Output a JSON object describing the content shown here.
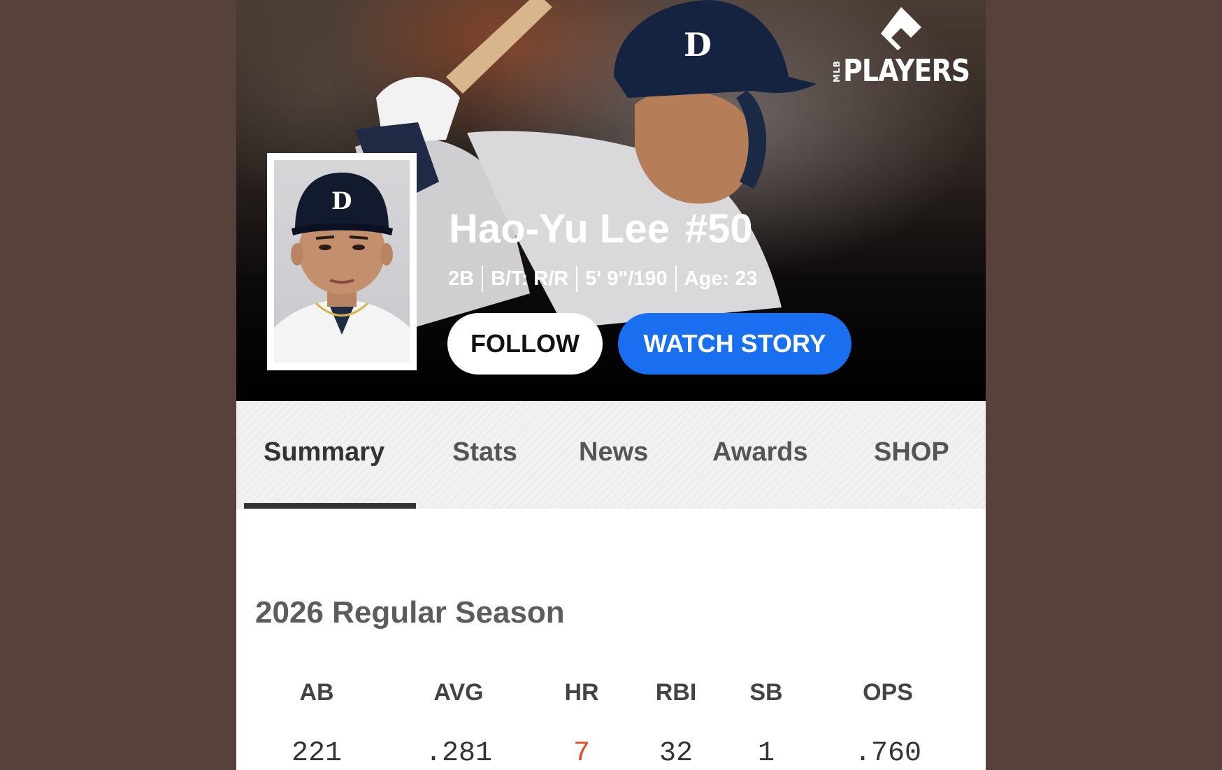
{
  "brand": {
    "mlb": "MLB",
    "players": "PLAYERS"
  },
  "player": {
    "name": "Hao-Yu Lee",
    "number": "#50",
    "position": "2B",
    "bats_throws": "B/T: R/R",
    "height_weight": "5' 9\"/190",
    "age": "Age: 23"
  },
  "buttons": {
    "follow": "FOLLOW",
    "watch_story": "WATCH STORY"
  },
  "tabs": [
    {
      "label": "Summary",
      "active": true
    },
    {
      "label": "Stats",
      "active": false
    },
    {
      "label": "News",
      "active": false
    },
    {
      "label": "Awards",
      "active": false
    },
    {
      "label": "SHOP",
      "active": false
    }
  ],
  "season": {
    "title": "2026 Regular Season",
    "stats": [
      {
        "label": "AB",
        "value": "221"
      },
      {
        "label": "AVG",
        "value": ".281"
      },
      {
        "label": "HR",
        "value": "7",
        "highlight": true
      },
      {
        "label": "RBI",
        "value": "32"
      },
      {
        "label": "SB",
        "value": "1"
      },
      {
        "label": "OPS",
        "value": ".760"
      }
    ]
  },
  "colors": {
    "background": "#56423b",
    "watch_button": "#1a6ff0",
    "highlight_stat": "#e04b2a"
  }
}
